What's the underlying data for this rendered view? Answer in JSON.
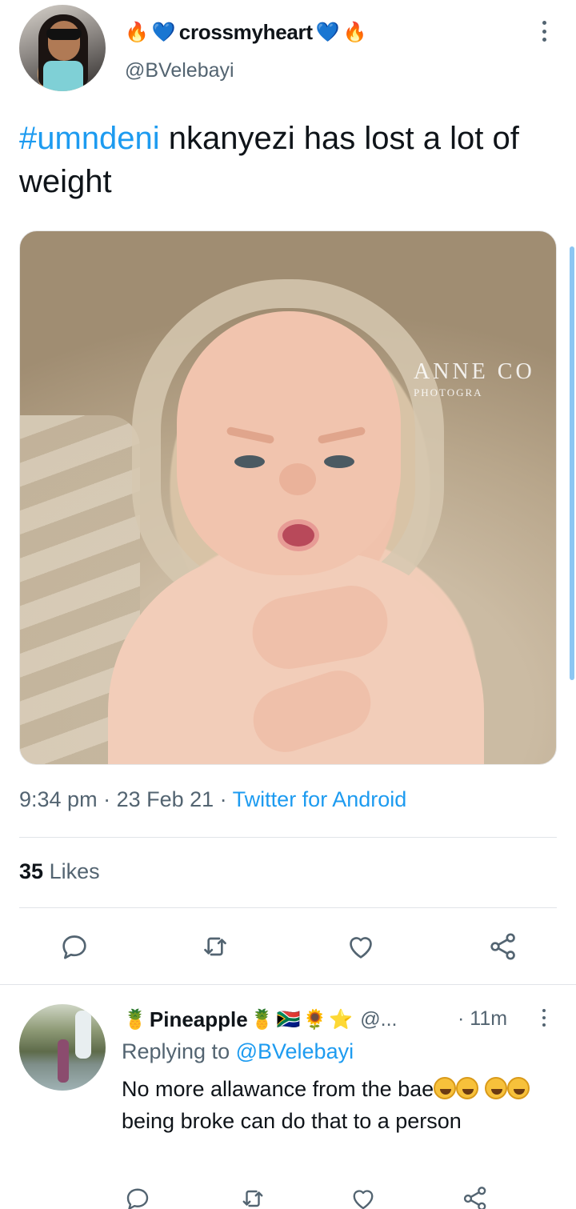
{
  "tweet": {
    "display_name": "crossmyheart",
    "handle": "@BVelebayi",
    "hashtag": "#umndeni",
    "text": " nkanyezi has lost a lot of weight",
    "media_watermark": {
      "line1": "ANNE CO",
      "line2": "PHOTOGRA"
    },
    "time": "9:34 pm",
    "date": "23 Feb 21",
    "source": "Twitter for Android",
    "likes_count": "35",
    "likes_label": "Likes",
    "name_emojis": {
      "fire": "🔥",
      "heart": "💙"
    }
  },
  "reply": {
    "display_name": "Pineapple",
    "name_emojis": [
      "🍍",
      "🍍",
      "🇿🇦",
      "🌻",
      "⭐"
    ],
    "handle": "@...",
    "time": "· 11m",
    "replying_prefix": "Replying to ",
    "replying_to": "@BVelebayi",
    "text_part1": "No more allawance from the bae",
    "text_part2": " being broke can do that to a person"
  },
  "icons": {
    "reply": "reply-icon",
    "retweet": "retweet-icon",
    "like": "heart-icon",
    "share": "share-icon",
    "more": "more-vertical-icon"
  },
  "colors": {
    "link": "#1d9bf0",
    "secondary_text": "#536471",
    "primary_text": "#0f1419"
  }
}
